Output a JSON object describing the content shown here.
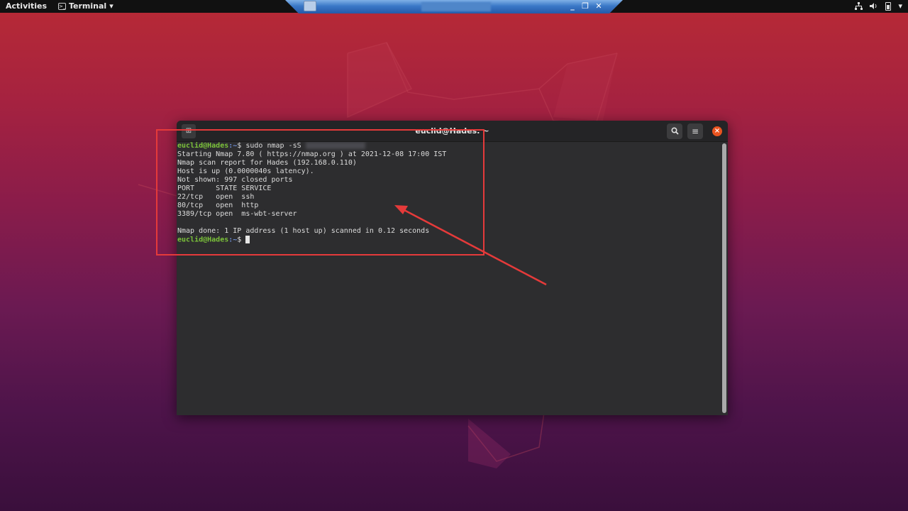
{
  "topbar": {
    "activities": "Activities",
    "app_name": "Terminal",
    "app_arrow": "▾",
    "tray_icons": [
      "network-icon",
      "volume-icon",
      "battery-icon",
      "power-menu-icon"
    ]
  },
  "remote_bar": {
    "minimize": "_",
    "restore": "❐",
    "close": "✕"
  },
  "terminal": {
    "title": "euclid@Hades: ~",
    "lines": [
      {
        "type": "prompt",
        "user": "euclid@Hades",
        "path": ":~",
        "cmd": "$ sudo nmap -sS "
      },
      {
        "type": "out",
        "text": "Starting Nmap 7.80 ( https://nmap.org ) at 2021-12-08 17:00 IST"
      },
      {
        "type": "out",
        "text": "Nmap scan report for Hades (192.168.0.110)"
      },
      {
        "type": "out",
        "text": "Host is up (0.0000040s latency)."
      },
      {
        "type": "out",
        "text": "Not shown: 997 closed ports"
      },
      {
        "type": "out",
        "text": "PORT     STATE SERVICE"
      },
      {
        "type": "out",
        "text": "22/tcp   open  ssh"
      },
      {
        "type": "out",
        "text": "80/tcp   open  http"
      },
      {
        "type": "out",
        "text": "3389/tcp open  ms-wbt-server"
      },
      {
        "type": "out",
        "text": ""
      },
      {
        "type": "out",
        "text": "Nmap done: 1 IP address (1 host up) scanned in 0.12 seconds"
      },
      {
        "type": "prompt_end",
        "user": "euclid@Hades",
        "path": ":~",
        "cmd": "$ "
      }
    ]
  },
  "colors": {
    "annotation": "#e53a3a",
    "prompt_user": "#7bc23a",
    "prompt_path": "#6e8fd6",
    "close_button": "#e95420"
  }
}
